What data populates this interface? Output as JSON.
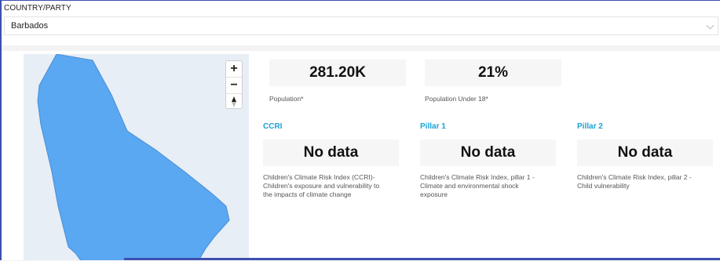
{
  "filter": {
    "label": "COUNTRY/PARTY",
    "selected": "Barbados"
  },
  "map": {
    "zoom_in_label": "+",
    "zoom_out_label": "−",
    "land_color": "#5aa7f2",
    "water_color": "#e8eef6"
  },
  "stats": {
    "population": {
      "value": "281.20K",
      "label": "Population*"
    },
    "under18": {
      "value": "21%",
      "label": "Population Under 18*"
    }
  },
  "indices": [
    {
      "title": "CCRI",
      "value": "No data",
      "desc_lines": [
        "Children's Climate Risk Index (CCRI)-",
        "Children's exposure and vulnerability to",
        "the impacts of climate change"
      ]
    },
    {
      "title": "Pillar 1",
      "value": "No data",
      "desc_lines": [
        "Children's Climate Risk Index, pillar 1 -",
        "Climate and environmental shock",
        "exposure"
      ]
    },
    {
      "title": "Pillar 2",
      "value": "No data",
      "desc_lines": [
        "Children's Climate Risk Index, pillar 2 -",
        "Child vulnerability"
      ]
    }
  ],
  "colors": {
    "accent": "#1ba1d6",
    "frame_border": "#3d4fb0"
  }
}
